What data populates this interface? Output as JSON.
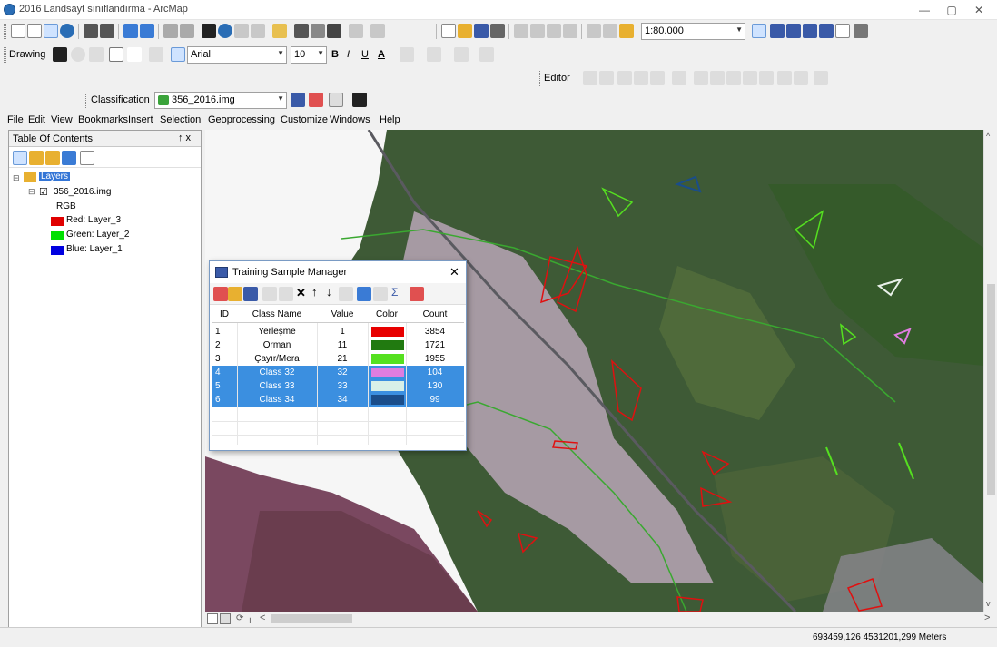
{
  "window": {
    "title": "2016 Landsayt sınıflandırma - ArcMap"
  },
  "toolbar1": {
    "scale": "1:80.000"
  },
  "toolbar2": {
    "drawing_label": "Drawing",
    "font_name": "Arial",
    "font_size": "10",
    "bold": "B",
    "italic": "I",
    "underline": "U",
    "font_color_a": "A"
  },
  "toolbar3": {
    "editor_label": "Editor"
  },
  "toolbar4": {
    "classification_label": "Classification",
    "layer_select": "356_2016.img"
  },
  "menu": [
    "File",
    "Edit",
    "View",
    "Bookmarks",
    "Insert",
    "Selection",
    "Geoprocessing",
    "Customize",
    "Windows",
    "Help"
  ],
  "toc": {
    "title": "Table Of Contents",
    "pin": "↑ x",
    "layers_label": "Layers",
    "layer_name": "356_2016.img",
    "rgb_label": "RGB",
    "bands": [
      {
        "label": "Red:  Layer_3",
        "color": "#e00000"
      },
      {
        "label": "Green: Layer_2",
        "color": "#00e000"
      },
      {
        "label": "Blue:  Layer_1",
        "color": "#0000e0"
      }
    ]
  },
  "dialog": {
    "title": "Training Sample Manager",
    "columns": [
      "ID",
      "Class Name",
      "Value",
      "Color",
      "Count"
    ],
    "rows": [
      {
        "id": "1",
        "name": "Yerleşme",
        "value": "1",
        "color": "#e80000",
        "count": "3854",
        "selected": false
      },
      {
        "id": "2",
        "name": "Orman",
        "value": "11",
        "color": "#217a10",
        "count": "1721",
        "selected": false
      },
      {
        "id": "3",
        "name": "Çayır/Mera",
        "value": "21",
        "color": "#55e020",
        "count": "1955",
        "selected": false
      },
      {
        "id": "4",
        "name": "Class 32",
        "value": "32",
        "color": "#e07de0",
        "count": "104",
        "selected": true
      },
      {
        "id": "5",
        "name": "Class 33",
        "value": "33",
        "color": "#d8f0e8",
        "count": "130",
        "selected": true
      },
      {
        "id": "6",
        "name": "Class 34",
        "value": "34",
        "color": "#1a4d8a",
        "count": "99",
        "selected": true
      }
    ]
  },
  "status": {
    "coords": "693459,126  4531201,299 Meters"
  }
}
